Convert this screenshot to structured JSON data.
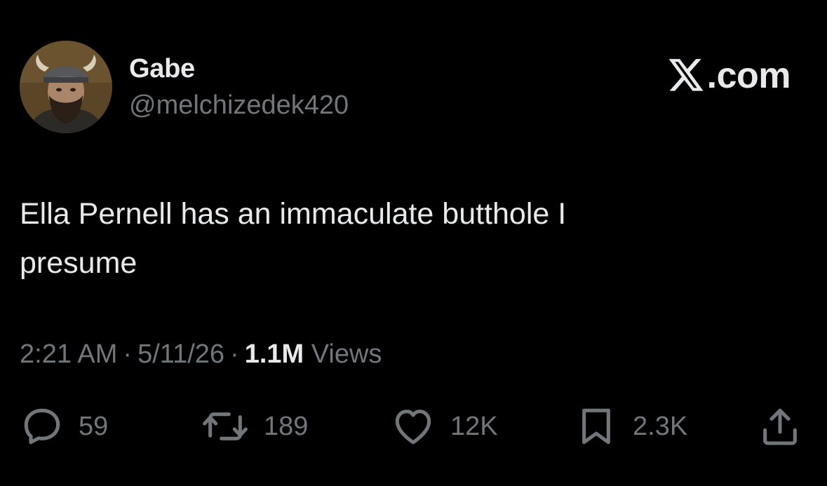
{
  "author": {
    "display_name": "Gabe",
    "handle": "@melchizedek420",
    "avatar_icon": "avatar-bearded-man-helmet"
  },
  "brand": {
    "logo_icon": "x-logo-icon",
    "text": ".com"
  },
  "tweet": {
    "text_line1": "Ella Pernell has an immaculate butthole I",
    "text_line2": "presume"
  },
  "meta": {
    "time": "2:21 AM",
    "date": "5/11/26",
    "views_count": "1.1M",
    "views_label": "Views",
    "separator": "·"
  },
  "actions": {
    "replies": "59",
    "reposts": "189",
    "likes": "12K",
    "bookmarks": "2.3K"
  },
  "colors": {
    "background": "#000000",
    "primary_text": "#e7e9ea",
    "secondary_text": "#71767b"
  }
}
